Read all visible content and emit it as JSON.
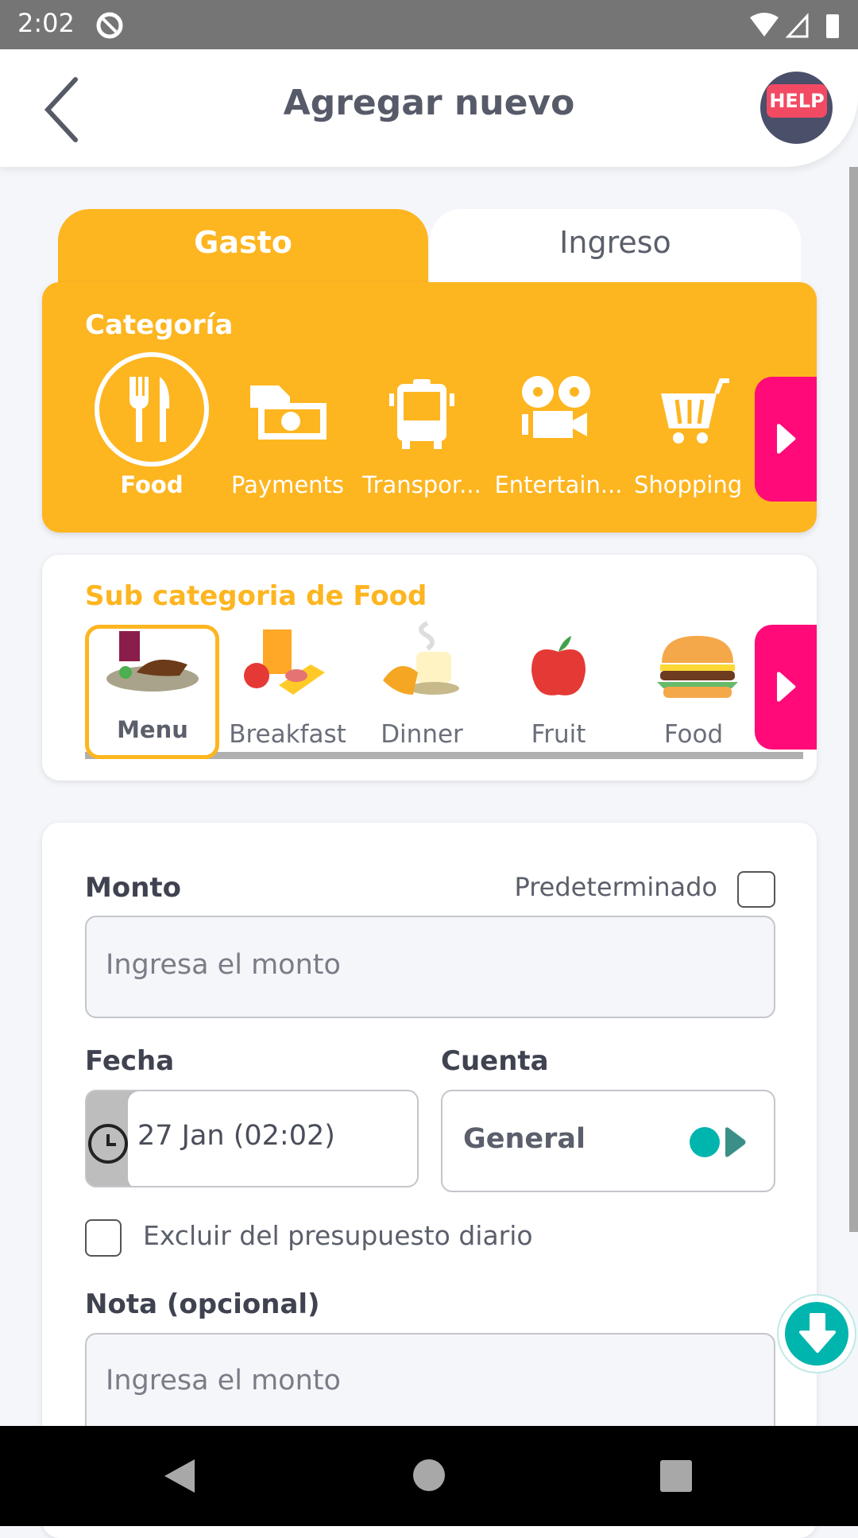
{
  "status_bar": {
    "time": "2:02"
  },
  "header": {
    "title": "Agregar nuevo",
    "help_label": "HELP"
  },
  "tabs": [
    {
      "label": "Gasto",
      "active": true
    },
    {
      "label": "Ingreso",
      "active": false
    }
  ],
  "category": {
    "title": "Categoría",
    "items": [
      {
        "label": "Food",
        "icon": "fork-knife-icon",
        "selected": true
      },
      {
        "label": "Payments",
        "icon": "money-hand-icon"
      },
      {
        "label": "Transpor...",
        "icon": "bus-icon"
      },
      {
        "label": "Entertain...",
        "icon": "film-camera-icon"
      },
      {
        "label": "Shopping",
        "icon": "cart-icon"
      }
    ]
  },
  "subcategory": {
    "title": "Sub categoria de Food",
    "items": [
      {
        "label": "Menu",
        "selected": true
      },
      {
        "label": "Breakfast"
      },
      {
        "label": "Dinner"
      },
      {
        "label": "Fruit"
      },
      {
        "label": "Food"
      }
    ]
  },
  "form": {
    "amount_label": "Monto",
    "default_label": "Predeterminado",
    "default_checked": false,
    "amount_placeholder": "Ingresa el monto",
    "date_label": "Fecha",
    "date_value": "27 Jan (02:02)",
    "account_label": "Cuenta",
    "account_value": "General",
    "exclude_label": "Excluir del presupuesto diario",
    "exclude_checked": false,
    "note_label": "Nota (opcional)",
    "note_placeholder": "Ingresa el monto"
  },
  "colors": {
    "accent": "#fdb520",
    "pink": "#ff0a78",
    "teal": "#00b5ad",
    "text": "#3f4350"
  }
}
